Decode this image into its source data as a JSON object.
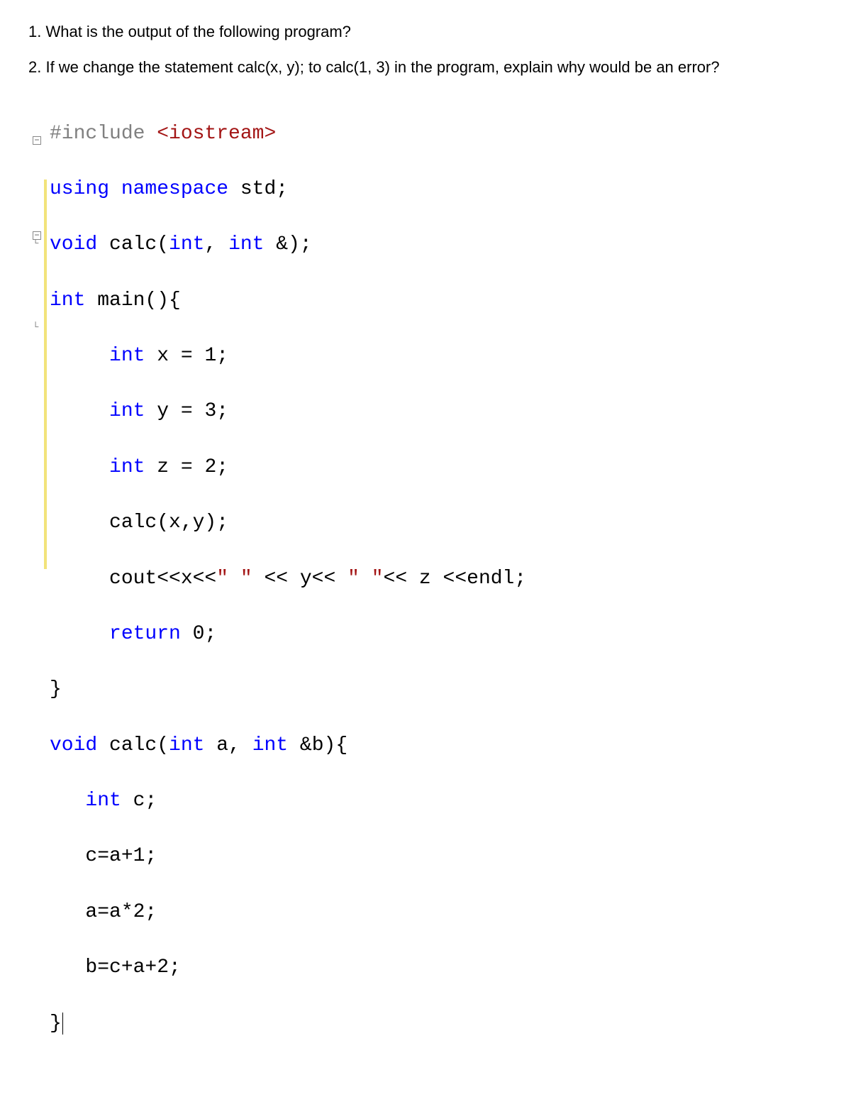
{
  "questions": {
    "q1": "1. What is the output of the following program?",
    "q2": "2. If we change the statement calc(x, y); to calc(1, 3) in the program, explain why would be an error?"
  },
  "code": {
    "l01a": "#include ",
    "l01b": "<iostream>",
    "l02a": "using",
    "l02b": " ",
    "l02c": "namespace",
    "l02d": " std;",
    "l03a": "void",
    "l03b": " calc(",
    "l03c": "int",
    "l03d": ", ",
    "l03e": "int",
    "l03f": " &);",
    "l04a": "int",
    "l04b": " main(){",
    "l05a": "     ",
    "l05b": "int",
    "l05c": " x = 1;",
    "l06a": "     ",
    "l06b": "int",
    "l06c": " y = 3;",
    "l07a": "     ",
    "l07b": "int",
    "l07c": " z = 2;",
    "l08": "     calc(x,y);",
    "l09a": "     cout<<x<<",
    "l09b": "\" \"",
    "l09c": " << y<< ",
    "l09d": "\" \"",
    "l09e": "<< z <<endl;",
    "l10a": "     ",
    "l10b": "return",
    "l10c": " 0;",
    "l11": "}",
    "l12a": "void",
    "l12b": " calc(",
    "l12c": "int",
    "l12d": " a, ",
    "l12e": "int",
    "l12f": " &b){",
    "l13a": "   ",
    "l13b": "int",
    "l13c": " c;",
    "l14": "   c=a+1;",
    "l15": "   a=a*2;",
    "l16": "   b=c+a+2;",
    "l17": "}"
  }
}
